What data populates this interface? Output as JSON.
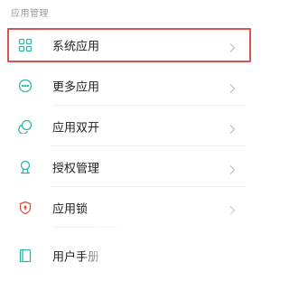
{
  "section": {
    "title": "应用管理"
  },
  "items": [
    {
      "label": "系统应用",
      "icon": "grid-icon"
    },
    {
      "label": "更多应用",
      "icon": "more-circle-icon"
    },
    {
      "label": "应用双开",
      "icon": "dual-circle-icon"
    },
    {
      "label": "授权管理",
      "icon": "badge-icon"
    },
    {
      "label": "应用锁",
      "icon": "shield-lock-icon"
    },
    {
      "label": "用户手册",
      "icon": "book-icon"
    }
  ],
  "colors": {
    "accent": "#2ab7a9",
    "highlight_border": "#d9534f",
    "lock_icon": "#e0503f"
  }
}
